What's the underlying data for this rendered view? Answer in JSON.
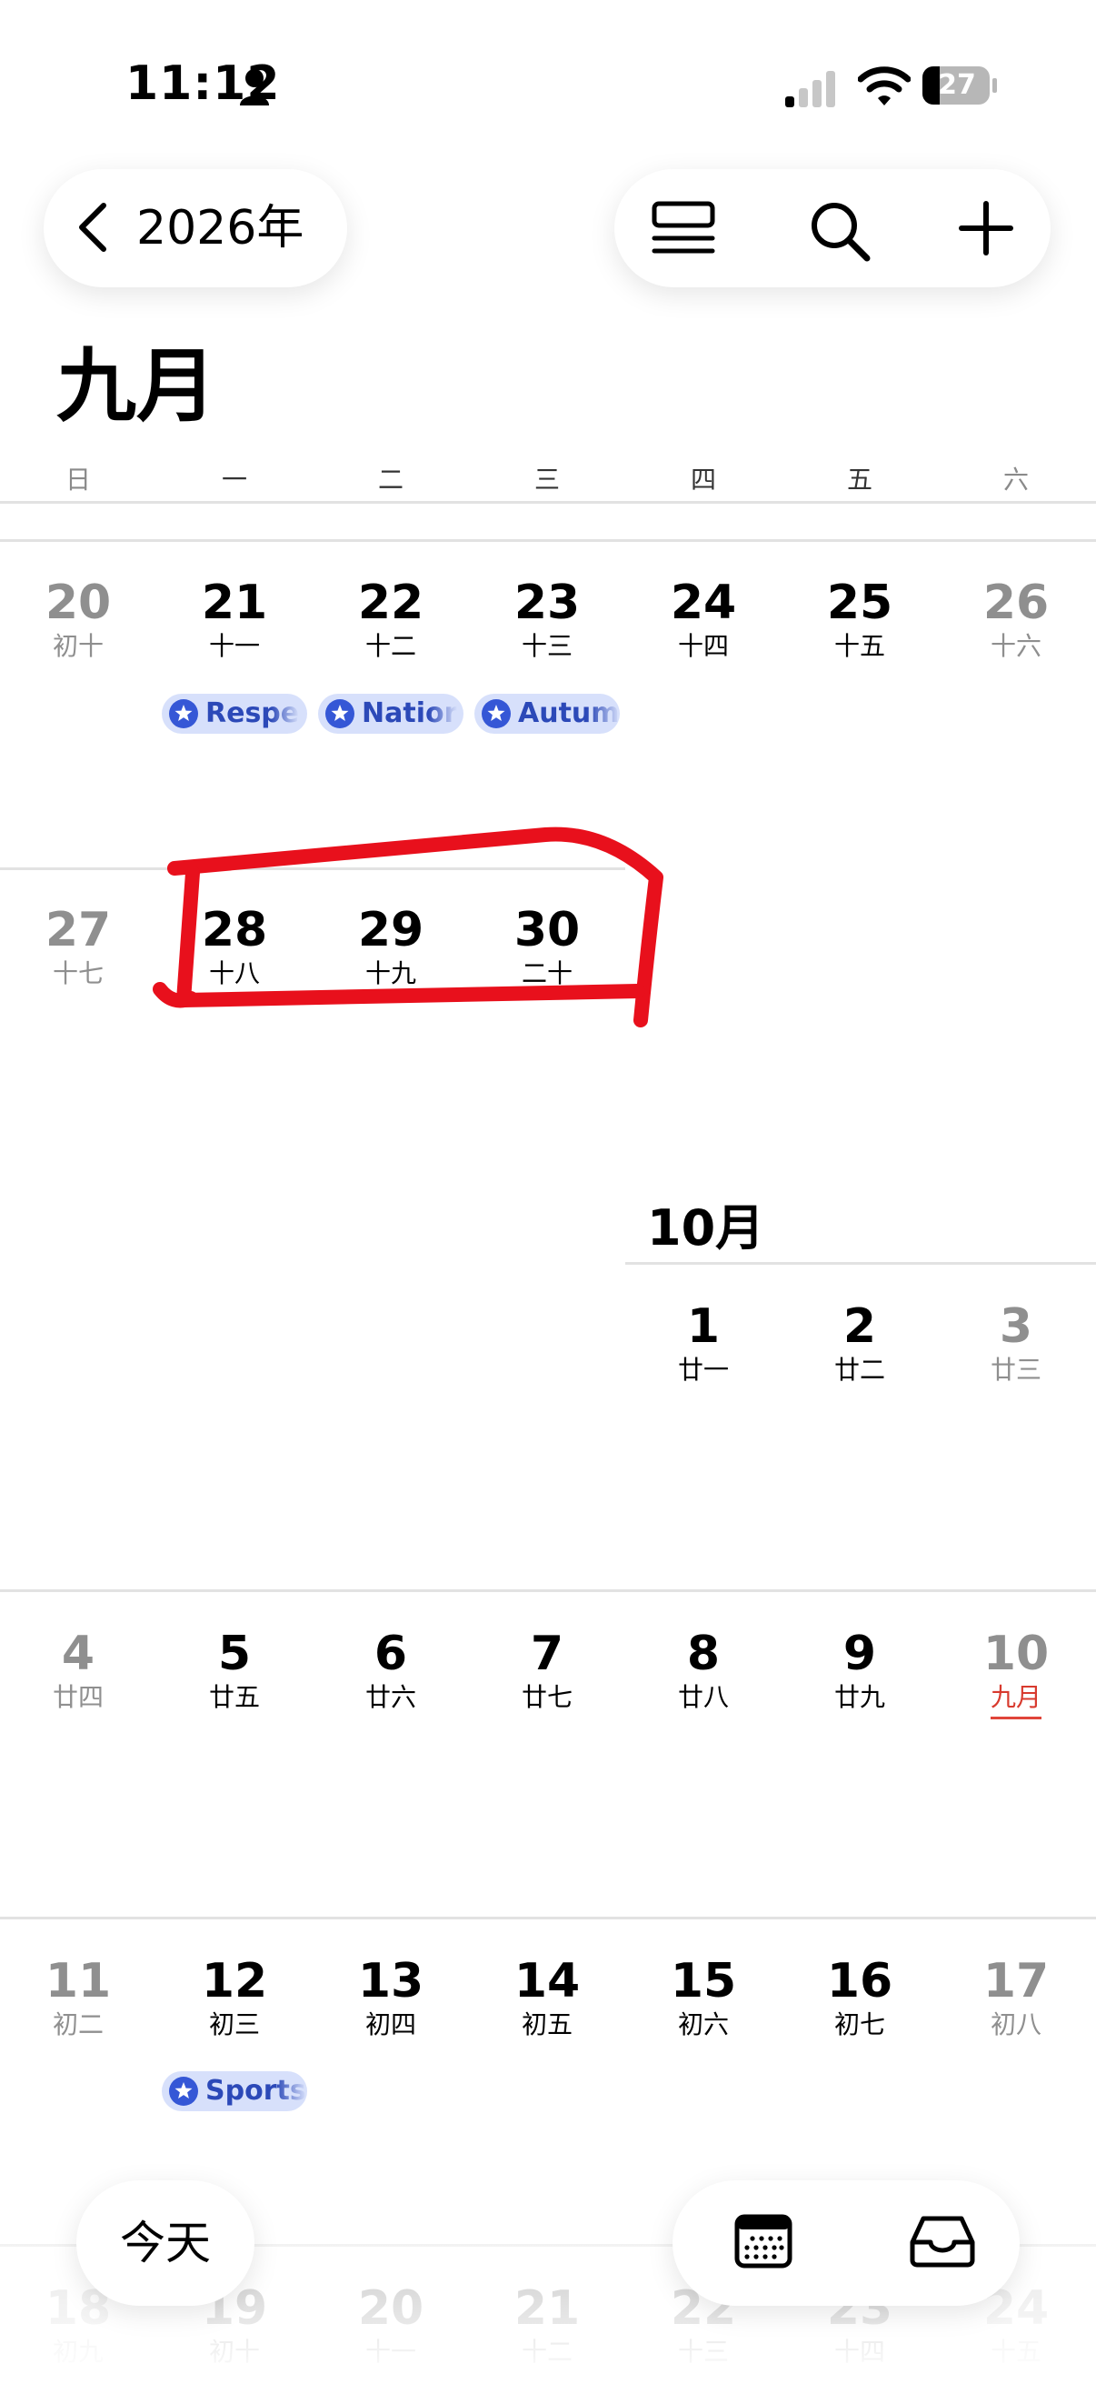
{
  "status_bar": {
    "time": "11:12",
    "battery": "27"
  },
  "nav": {
    "year_label": "2026年"
  },
  "month": {
    "title": "九月"
  },
  "weekdays": [
    "日",
    "一",
    "二",
    "三",
    "四",
    "五",
    "六"
  ],
  "week_sep20": {
    "days": [
      {
        "num": "20",
        "lunar": "初十"
      },
      {
        "num": "21",
        "lunar": "十一"
      },
      {
        "num": "22",
        "lunar": "十二"
      },
      {
        "num": "23",
        "lunar": "十三"
      },
      {
        "num": "24",
        "lunar": "十四"
      },
      {
        "num": "25",
        "lunar": "十五"
      },
      {
        "num": "26",
        "lunar": "十六"
      }
    ],
    "events": [
      "Respe",
      "Natior",
      "Autum"
    ]
  },
  "week_sep27": {
    "days": [
      {
        "num": "27",
        "lunar": "十七"
      },
      {
        "num": "28",
        "lunar": "十八"
      },
      {
        "num": "29",
        "lunar": "十九"
      },
      {
        "num": "30",
        "lunar": "二十"
      }
    ]
  },
  "october": {
    "label": "10月",
    "days": [
      {
        "num": "1",
        "lunar": "廿一"
      },
      {
        "num": "2",
        "lunar": "廿二"
      },
      {
        "num": "3",
        "lunar": "廿三"
      }
    ]
  },
  "week_oct4": {
    "days": [
      {
        "num": "4",
        "lunar": "廿四"
      },
      {
        "num": "5",
        "lunar": "廿五"
      },
      {
        "num": "6",
        "lunar": "廿六"
      },
      {
        "num": "7",
        "lunar": "廿七"
      },
      {
        "num": "8",
        "lunar": "廿八"
      },
      {
        "num": "9",
        "lunar": "廿九"
      },
      {
        "num": "10",
        "lunar": "九月"
      }
    ]
  },
  "week_oct11": {
    "days": [
      {
        "num": "11",
        "lunar": "初二"
      },
      {
        "num": "12",
        "lunar": "初三"
      },
      {
        "num": "13",
        "lunar": "初四"
      },
      {
        "num": "14",
        "lunar": "初五"
      },
      {
        "num": "15",
        "lunar": "初六"
      },
      {
        "num": "16",
        "lunar": "初七"
      },
      {
        "num": "17",
        "lunar": "初八"
      }
    ],
    "events": [
      "Sports"
    ]
  },
  "week_oct18": {
    "days": [
      {
        "num": "18",
        "lunar": "初九"
      },
      {
        "num": "19",
        "lunar": "初十"
      },
      {
        "num": "20",
        "lunar": "十一"
      },
      {
        "num": "21",
        "lunar": "十二"
      },
      {
        "num": "22",
        "lunar": "十三"
      },
      {
        "num": "23",
        "lunar": "十四"
      },
      {
        "num": "24",
        "lunar": "十五"
      }
    ]
  },
  "bottom": {
    "today_label": "今天"
  },
  "colors": {
    "event_bg": "#d7e0fb",
    "event_text": "#2c49b8",
    "annotation": "#e8101c",
    "holiday_underline": "#e0453a"
  },
  "icons": [
    "person-icon",
    "signal-icon",
    "wifi-icon",
    "battery-icon",
    "chevron-left-icon",
    "list-view-icon",
    "search-icon",
    "add-icon",
    "star-icon",
    "calendar-view-icon",
    "inbox-icon"
  ]
}
